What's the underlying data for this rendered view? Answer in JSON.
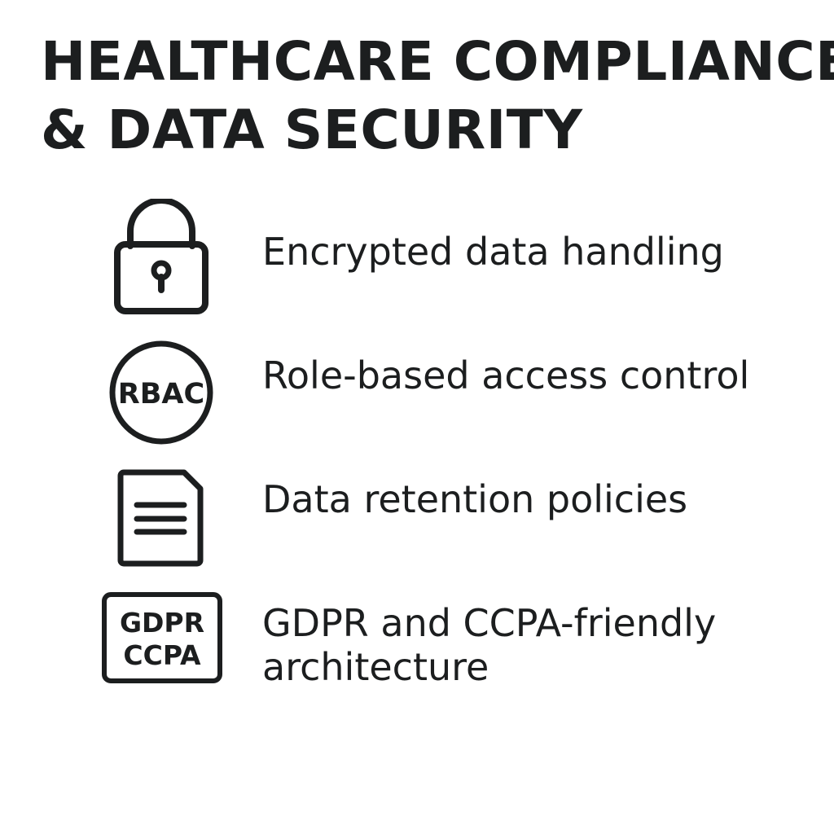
{
  "header": {
    "title_line1": "HEALTHCARE COMPLIANCE",
    "title_line2": "& DATA SECURITY"
  },
  "features": [
    {
      "icon": "lock-icon",
      "label": "Encrypted data handling"
    },
    {
      "icon": "rbac-badge-icon",
      "icon_text": "RBAC",
      "label": "Role-based access control"
    },
    {
      "icon": "document-icon",
      "label": "Data retention policies"
    },
    {
      "icon": "gdpr-ccpa-badge-icon",
      "icon_text_line1": "GDPR",
      "icon_text_line2": "CCPA",
      "label_line1": "GDPR and CCPA-friendly",
      "label_line2": "architecture"
    }
  ],
  "colors": {
    "text": "#1c1e1f",
    "background": "#ffffff"
  }
}
